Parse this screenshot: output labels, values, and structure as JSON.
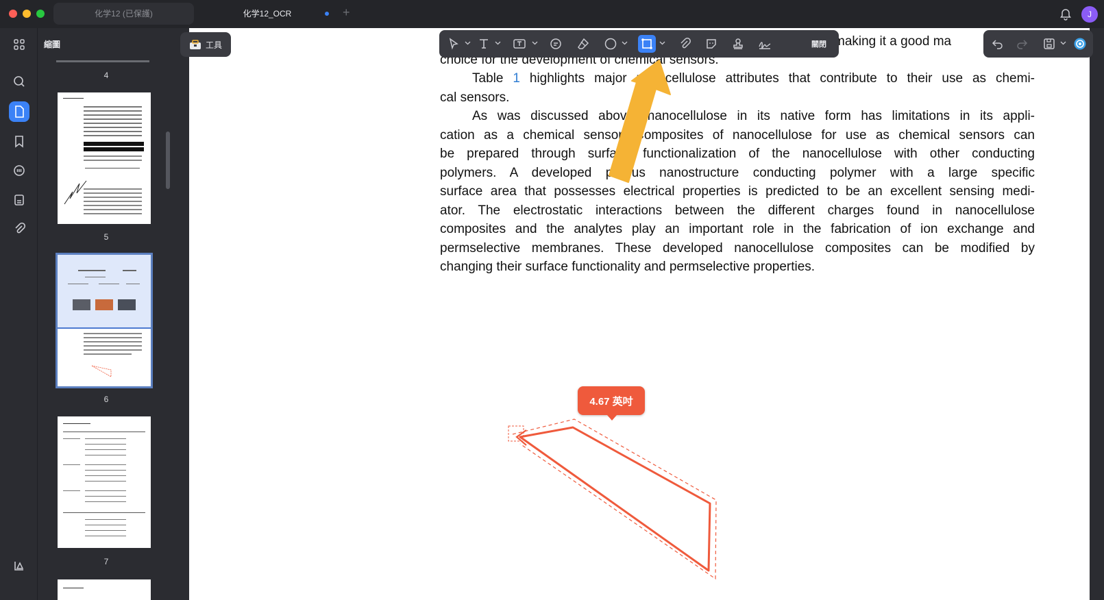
{
  "window": {
    "tabs": [
      {
        "label": "化学12 (已保護)"
      },
      {
        "label": "化学12_OCR"
      }
    ],
    "avatar_initial": "J"
  },
  "sidebar": {
    "title": "縮圖",
    "pages": [
      {
        "label": "4"
      },
      {
        "label": "5"
      },
      {
        "label": "6"
      },
      {
        "label": "7"
      }
    ]
  },
  "toolbar": {
    "tools_label": "工具",
    "close_label": "關閉"
  },
  "document": {
    "line_top_right": "making it a good ma",
    "line_top": "choice for the development of chemical sensors.",
    "para1": {
      "before_link": "Table ",
      "link": "1",
      "after_link": " highlights major nanocellulose attributes that contribute to their use as chemi-",
      "line2": "cal sensors."
    },
    "para2_lines": [
      "As was discussed above, nanocellulose in its native form has limitations in its appli-",
      "cation as a chemical sensor. Composites of nanocellulose for use as chemical sensors can",
      "be prepared through surface functionalization of the nanocellulose with other conducting",
      "polymers. A developed porous nanostructure conducting polymer with a large specific",
      "surface area that possesses electrical properties is predicted to be an excellent sensing medi-",
      "ator. The electrostatic interactions between the different charges found in nanocellulose",
      "composites and the analytes play an important role in the fabrication of ion exchange and",
      "permselective membranes. These developed nanocellulose composites can be modified by",
      "changing their surface functionality and permselective properties."
    ]
  },
  "measurement": {
    "label": "4.67 英吋",
    "color": "#ef5a3c"
  },
  "colors": {
    "accent": "#3b82f6",
    "arrow": "#f5b335"
  }
}
